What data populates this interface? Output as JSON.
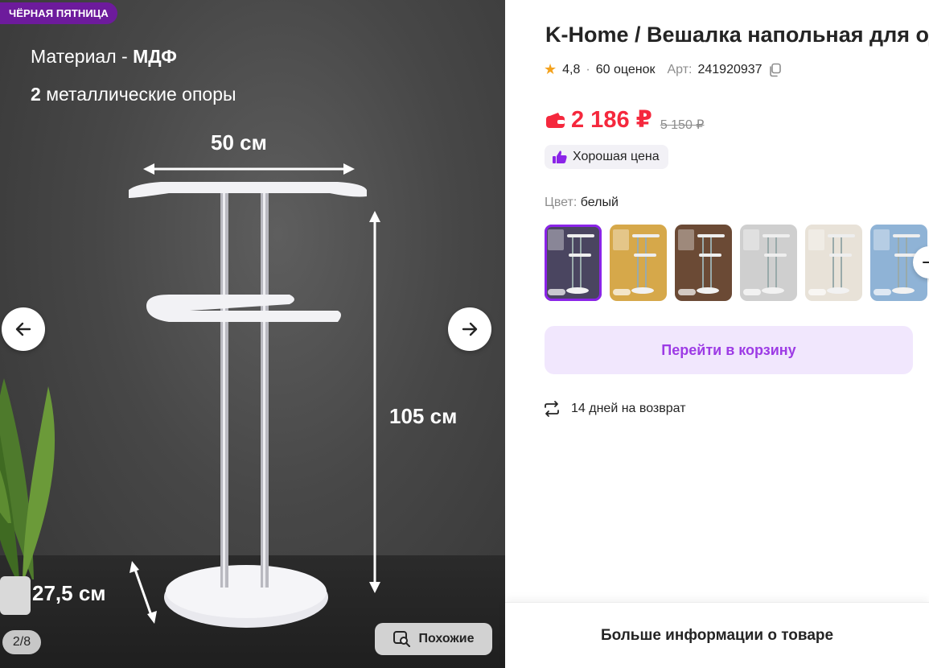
{
  "gallery": {
    "badge": "ЧЁРНАЯ ПЯТНИЦА",
    "material_label": "Материал -",
    "material_value": "МДФ",
    "supports_count": "2",
    "supports_text": "металлические опоры",
    "dim_width": "50 см",
    "dim_height": "105 см",
    "dim_depth": "27,5 см",
    "counter": "2/8",
    "similar_label": "Похожие"
  },
  "product": {
    "title": "K-Home / Вешалка напольная для одежды",
    "rating": "4,8",
    "separator": "·",
    "reviews": "60 оценок",
    "article_label": "Арт:",
    "article_value": "241920937",
    "price": "2 186 ₽",
    "old_price": "5 150 ₽",
    "good_price_label": "Хорошая цена",
    "color_label": "Цвет:",
    "color_value": "белый"
  },
  "thumbnails": [
    {
      "name": "Вешалка белая (фиолетовый фон)",
      "bg": "#4a4560",
      "selected": true
    },
    {
      "name": "Вешалка (жёлтый фон)",
      "bg": "#d6a84a",
      "selected": false
    },
    {
      "name": "Вешалка (коричневый фон)",
      "bg": "#6b4a35",
      "selected": false
    },
    {
      "name": "Вешалка (серый фон)",
      "bg": "#cfcfcf",
      "selected": false
    },
    {
      "name": "Вешалка (бежевый фон)",
      "bg": "#e8e2d8",
      "selected": false
    },
    {
      "name": "Вешалка (голубой фон)",
      "bg": "#8fb3d6",
      "selected": false
    }
  ],
  "actions": {
    "go_to_cart": "Перейти в корзину",
    "returns": "14 дней на возврат",
    "more_info": "Больше информации о товаре"
  },
  "colors": {
    "price_red": "#f5283d",
    "accent_purple": "#8b24e8",
    "badge_purple": "#6d1b9c",
    "cart_bg": "#f1e7fd"
  }
}
